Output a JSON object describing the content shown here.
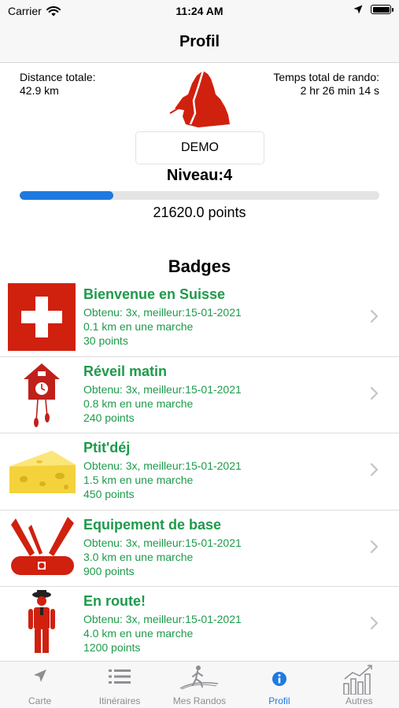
{
  "status_bar": {
    "carrier": "Carrier",
    "time": "11:24 AM"
  },
  "nav": {
    "title": "Profil"
  },
  "stats": {
    "distance_label": "Distance totale:",
    "distance_value": "42.9 km",
    "time_label": "Temps total de rando:",
    "time_value": "2 hr 26 min 14 s"
  },
  "profile": {
    "username": "DEMO",
    "level": "Niveau:4",
    "progress_fraction": 0.26,
    "points": "21620.0 points"
  },
  "badges_title": "Badges",
  "badges": [
    {
      "icon": "swiss-flag-icon",
      "name": "Bienvenue en Suisse",
      "obtained": "Obtenu: 3x, meilleur:15-01-2021",
      "distance": "0.1 km en une marche",
      "points": "30 points"
    },
    {
      "icon": "cuckoo-clock-icon",
      "name": "Réveil matin",
      "obtained": "Obtenu: 3x, meilleur:15-01-2021",
      "distance": "0.8 km en une marche",
      "points": "240 points"
    },
    {
      "icon": "cheese-icon",
      "name": "Ptit'déj",
      "obtained": "Obtenu: 3x, meilleur:15-01-2021",
      "distance": "1.5 km en une marche",
      "points": "450 points"
    },
    {
      "icon": "swiss-army-knife-icon",
      "name": "Equipement de base",
      "obtained": "Obtenu: 3x, meilleur:15-01-2021",
      "distance": "3.0 km en une marche",
      "points": "900 points"
    },
    {
      "icon": "hiker-figure-icon",
      "name": "En route!",
      "obtained": "Obtenu: 3x, meilleur:15-01-2021",
      "distance": "4.0 km en une marche",
      "points": "1200 points"
    }
  ],
  "tabs": [
    {
      "icon": "location-arrow-icon",
      "label": "Carte",
      "active": false
    },
    {
      "icon": "list-icon",
      "label": "Itinéraires",
      "active": false
    },
    {
      "icon": "hiker-icon",
      "label": "Mes Randos",
      "active": false
    },
    {
      "icon": "info-icon",
      "label": "Profil",
      "active": true
    },
    {
      "icon": "bar-chart-icon",
      "label": "Autres",
      "active": false
    }
  ],
  "colors": {
    "accent": "#1f7ae0",
    "badge_green": "#1e9a4b",
    "brand_red": "#d0200e"
  }
}
